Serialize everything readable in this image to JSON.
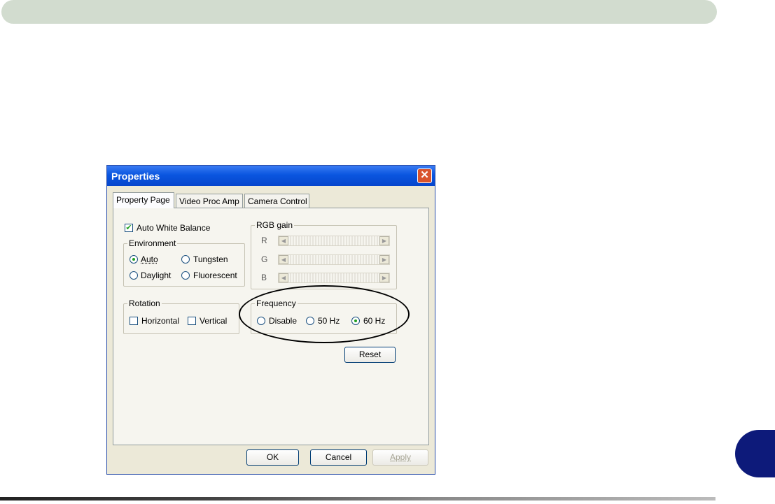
{
  "dialog": {
    "title": "Properties",
    "close_glyph": "✕",
    "tabs": [
      {
        "label": "Property Page"
      },
      {
        "label": "Video Proc Amp"
      },
      {
        "label": "Camera Control"
      }
    ],
    "auto_white_balance": {
      "label": "Auto White Balance",
      "checked": true,
      "check_glyph": "✔"
    },
    "environment": {
      "legend": "Environment",
      "options": [
        {
          "label": "Auto",
          "selected": true
        },
        {
          "label": "Tungsten",
          "selected": false
        },
        {
          "label": "Daylight",
          "selected": false
        },
        {
          "label": "Fluorescent",
          "selected": false
        }
      ]
    },
    "rgb_gain": {
      "legend": "RGB gain",
      "channels": [
        {
          "label": "R"
        },
        {
          "label": "G"
        },
        {
          "label": "B"
        }
      ],
      "left_arrow": "◀",
      "right_arrow": "▶"
    },
    "rotation": {
      "legend": "Rotation",
      "options": [
        {
          "label": "Horizontal",
          "checked": false
        },
        {
          "label": "Vertical",
          "checked": false
        }
      ]
    },
    "frequency": {
      "legend": "Frequency",
      "options": [
        {
          "label": "Disable",
          "selected": false
        },
        {
          "label": "50 Hz",
          "selected": false
        },
        {
          "label": "60 Hz",
          "selected": true
        }
      ]
    },
    "reset_label": "Reset",
    "ok_label": "OK",
    "cancel_label": "Cancel",
    "apply_label": "Apply"
  },
  "colors": {
    "header_bar": "#d2dccf",
    "page_tab": "#0d1a7a",
    "titlebar": "#0a56e0",
    "highlight_ellipse": "#000000"
  }
}
